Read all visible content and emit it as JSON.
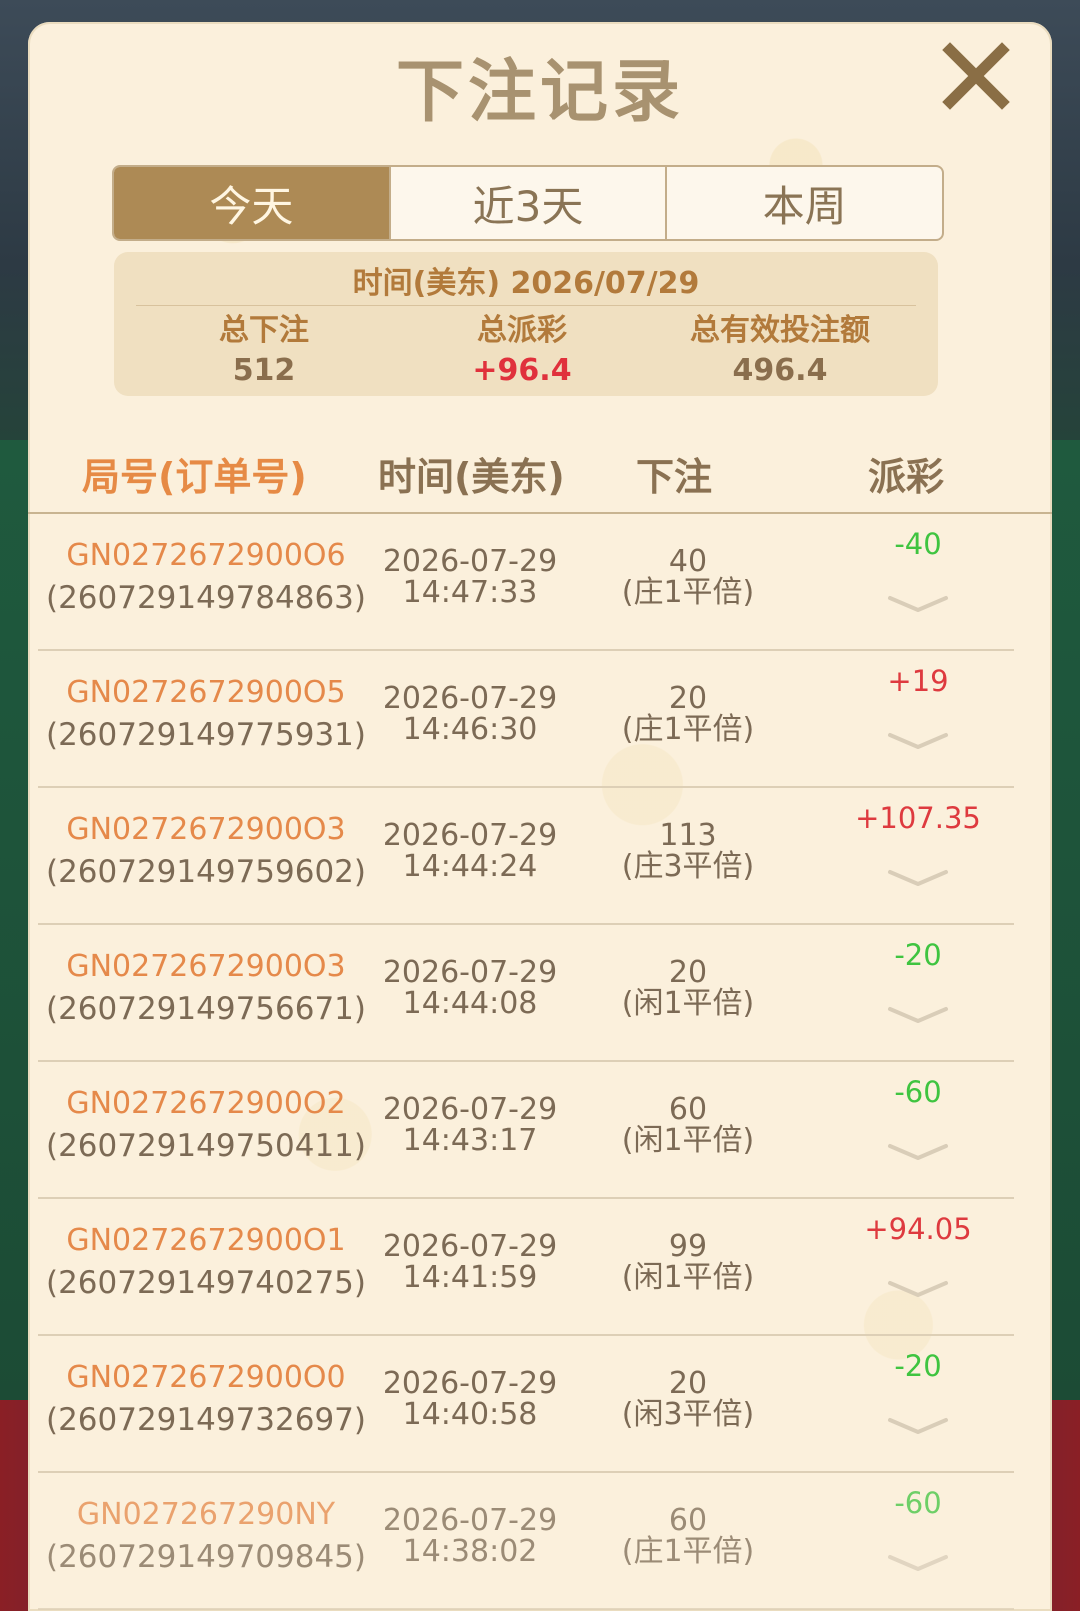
{
  "modal": {
    "title": "下注记录",
    "tabs": [
      {
        "label": "今天",
        "active": true
      },
      {
        "label": "近3天",
        "active": false
      },
      {
        "label": "本周",
        "active": false
      }
    ]
  },
  "summary": {
    "date_line": "时间(美东) 2026/07/29",
    "total_bet_label": "总下注",
    "total_bet_value": "512",
    "total_payout_label": "总派彩",
    "total_payout_value": "+96.4",
    "total_valid_label": "总有效投注额",
    "total_valid_value": "496.4"
  },
  "table": {
    "headers": {
      "id": "局号(订单号)",
      "time": "时间(美东)",
      "bet": "下注",
      "payout": "派彩"
    },
    "rows": [
      {
        "game_id": "GN0272672900O6",
        "order": "(260729149784863)",
        "date": "2026-07-29",
        "time": "14:47:33",
        "amount": "40",
        "bet_type": "(庄1平倍)",
        "payout": "-40",
        "sign": "neg"
      },
      {
        "game_id": "GN0272672900O5",
        "order": "(260729149775931)",
        "date": "2026-07-29",
        "time": "14:46:30",
        "amount": "20",
        "bet_type": "(庄1平倍)",
        "payout": "+19",
        "sign": "pos"
      },
      {
        "game_id": "GN0272672900O3",
        "order": "(260729149759602)",
        "date": "2026-07-29",
        "time": "14:44:24",
        "amount": "113",
        "bet_type": "(庄3平倍)",
        "payout": "+107.35",
        "sign": "pos"
      },
      {
        "game_id": "GN0272672900O3",
        "order": "(260729149756671)",
        "date": "2026-07-29",
        "time": "14:44:08",
        "amount": "20",
        "bet_type": "(闲1平倍)",
        "payout": "-20",
        "sign": "neg"
      },
      {
        "game_id": "GN0272672900O2",
        "order": "(260729149750411)",
        "date": "2026-07-29",
        "time": "14:43:17",
        "amount": "60",
        "bet_type": "(闲1平倍)",
        "payout": "-60",
        "sign": "neg"
      },
      {
        "game_id": "GN0272672900O1",
        "order": "(260729149740275)",
        "date": "2026-07-29",
        "time": "14:41:59",
        "amount": "99",
        "bet_type": "(闲1平倍)",
        "payout": "+94.05",
        "sign": "pos"
      },
      {
        "game_id": "GN0272672900O0",
        "order": "(260729149732697)",
        "date": "2026-07-29",
        "time": "14:40:58",
        "amount": "20",
        "bet_type": "(闲3平倍)",
        "payout": "-20",
        "sign": "neg"
      },
      {
        "game_id": "GN027267290NY",
        "order": "(260729149709845)",
        "date": "2026-07-29",
        "time": "14:38:02",
        "amount": "60",
        "bet_type": "(庄1平倍)",
        "payout": "-60",
        "sign": "neg"
      }
    ]
  },
  "icons": {
    "close": "close-icon",
    "expand": "chevron-down-icon"
  },
  "colors": {
    "accent": "#ad8a55",
    "positive": "#de3a3f",
    "negative": "#3fc440",
    "id_text": "#e5894a"
  }
}
